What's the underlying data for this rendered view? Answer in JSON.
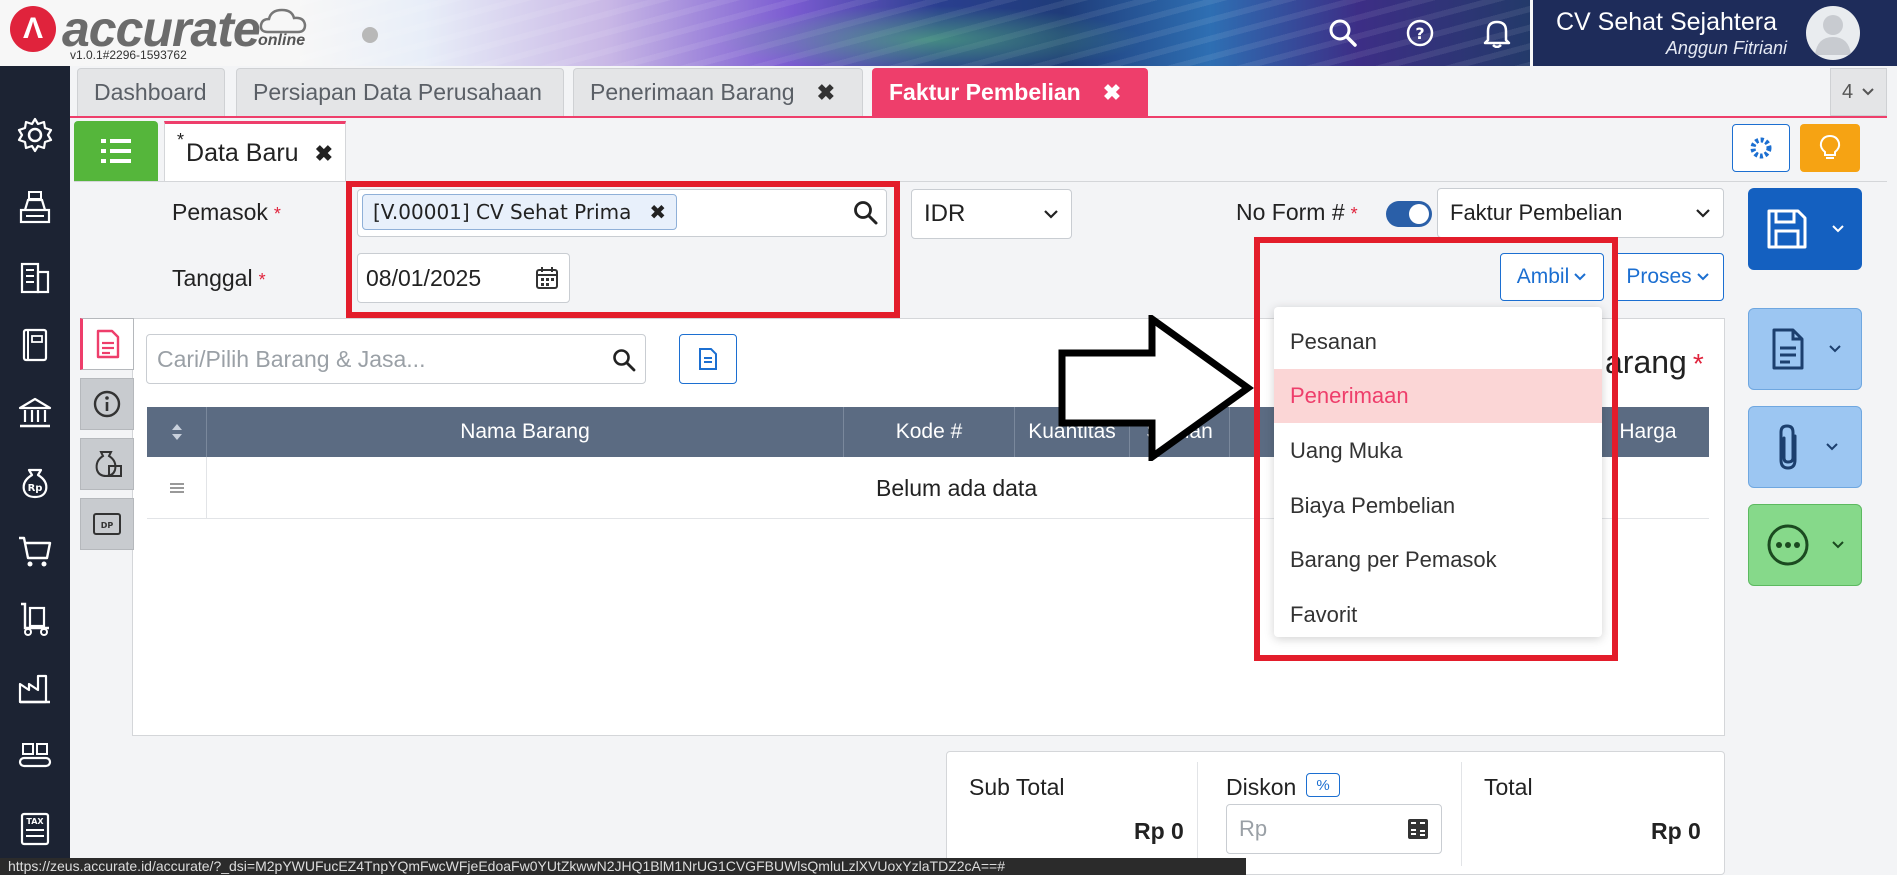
{
  "header": {
    "logo_text": "accurate",
    "logo_sub": "online",
    "version": "v1.0.1#2296-1593762",
    "company_name": "CV Sehat Sejahtera",
    "user_name": "Anggun Fitriani"
  },
  "tabs": [
    {
      "label": "Dashboard",
      "closable": false
    },
    {
      "label": "Persiapan Data Perusahaan",
      "closable": false
    },
    {
      "label": "Penerimaan Barang",
      "closable": true
    },
    {
      "label": "Faktur Pembelian",
      "closable": true,
      "active": true
    }
  ],
  "tab_count": "4",
  "close_glyph": "✖",
  "subtab": {
    "marker": "*",
    "label": "Data Baru"
  },
  "form": {
    "pemasok_label": "Pemasok",
    "pemasok_value": "[V.00001] CV Sehat Prima",
    "tanggal_label": "Tanggal",
    "tanggal_value": "08/01/2025",
    "currency": "IDR",
    "no_form_label": "No Form #",
    "form_type": "Faktur Pembelian",
    "required_mark": "*",
    "ambil_label": "Ambil",
    "proses_label": "Proses"
  },
  "detail": {
    "search_placeholder": "Cari/Pilih Barang & Jasa...",
    "section_title": "arang",
    "columns": [
      "Nama Barang",
      "Kode #",
      "Kuantitas",
      "Satuan",
      "Harga"
    ],
    "empty_text": "Belum ada data"
  },
  "dropdown": {
    "items": [
      "Pesanan",
      "Penerimaan",
      "Uang Muka",
      "Biaya Pembelian",
      "Barang per Pemasok",
      "Favorit"
    ],
    "highlighted": "Penerimaan"
  },
  "totals": {
    "sub_total_label": "Sub Total",
    "sub_total_value": "Rp 0",
    "diskon_label": "Diskon",
    "diskon_badge": "%",
    "diskon_placeholder": "Rp",
    "total_label": "Total",
    "total_value": "Rp 0"
  },
  "status_url": "https://zeus.accurate.id/accurate/?_dsi=M2pYWUFucEZ4TnpYQmFwcWFjeEdoaFw0YUtZkwwN2JHQ1BlM1NrUG1CVGFBUWlsQmluLzlXVUoxYzlaTDZ2cA==#",
  "colors": {
    "accent_pink": "#ee3e6b",
    "highlight_red": "#e31d2b",
    "sidebar_bg": "#1c2333",
    "primary_blue": "#1c6fd1",
    "green": "#55b63b",
    "orange": "#f6a313"
  }
}
